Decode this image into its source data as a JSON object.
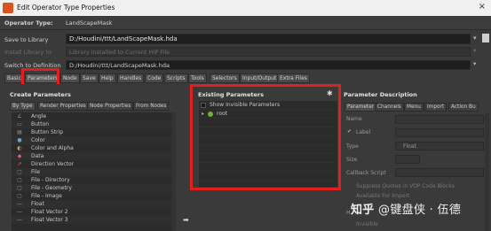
{
  "window": {
    "title": "Edit Operator Type Properties",
    "close": "×"
  },
  "operator_type": {
    "label": "Operator Type:",
    "value": "LandScapeMask"
  },
  "save_to_library": {
    "label": "Save to Library",
    "value": "D:/Houdini/ttt/LandScapeMask.hda"
  },
  "install_library": {
    "label": "Install Library to",
    "value": "Library installed to Current HIP File"
  },
  "switch_definition": {
    "label": "Switch to Definition",
    "value": "D:/Houdini/ttt/LandScapeMask.hda"
  },
  "tabs": [
    "Basic",
    "Parameters",
    "Node",
    "Save",
    "Help",
    "Handles",
    "Code",
    "Scripts",
    "Tools",
    "Selectors",
    "Input/Output",
    "Extra Files"
  ],
  "create_parameters": {
    "header": "Create Parameters",
    "subtabs": [
      "By Type",
      "Render Properties",
      "Node Properties",
      "From Nodes"
    ],
    "items": [
      {
        "icon": "angle-icon",
        "glyph": "∠",
        "label": "Angle"
      },
      {
        "icon": "button-icon",
        "glyph": "▭",
        "label": "Button"
      },
      {
        "icon": "button-strip-icon",
        "glyph": "▤",
        "label": "Button Strip"
      },
      {
        "icon": "color-icon",
        "glyph": "●",
        "label": "Color"
      },
      {
        "icon": "color-alpha-icon",
        "glyph": "◐",
        "label": "Color and Alpha"
      },
      {
        "icon": "data-icon",
        "glyph": "◆",
        "label": "Data"
      },
      {
        "icon": "direction-vector-icon",
        "glyph": "↗",
        "label": "Direction Vector"
      },
      {
        "icon": "file-icon",
        "glyph": "▢",
        "label": "File"
      },
      {
        "icon": "file-directory-icon",
        "glyph": "▢",
        "label": "File - Directory"
      },
      {
        "icon": "file-geometry-icon",
        "glyph": "▢",
        "label": "File - Geometry"
      },
      {
        "icon": "file-image-icon",
        "glyph": "▢",
        "label": "File - Image"
      },
      {
        "icon": "float-icon",
        "glyph": "—",
        "label": "Float"
      },
      {
        "icon": "float-vector2-icon",
        "glyph": "—",
        "label": "Float Vector 2"
      },
      {
        "icon": "float-vector3-icon",
        "glyph": "—",
        "label": "Float Vector 3"
      }
    ]
  },
  "existing_parameters": {
    "header": "Existing Parameters",
    "show_invisible": "Show Invisible Parameters",
    "root": "root"
  },
  "parameter_description": {
    "header": "Parameter Description",
    "tabs": [
      "Parameter",
      "Channels",
      "Menu",
      "Import",
      "Action Bu"
    ],
    "name_label": "Name",
    "label_label": "Label",
    "type_label": "Type",
    "type_value": "Float",
    "size_label": "Size",
    "callback_label": "Callback Script",
    "suppress_label": "Suppress Quotes in VOP Code Blocks",
    "available_label": "Available For Import",
    "invisible_label": "Invisible",
    "h_label": "H"
  },
  "watermark": {
    "prefix": "知乎",
    "text": "@键盘侠 · 伍德"
  },
  "colors": {
    "highlight": "#e0201c",
    "accent": "#d9541e",
    "root_icon": "#6fb23a"
  }
}
